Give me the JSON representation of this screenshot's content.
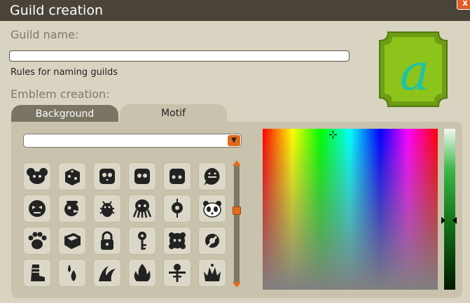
{
  "window": {
    "title": "Guild creation",
    "close_label": "x"
  },
  "form": {
    "guild_name_label": "Guild name:",
    "guild_name_value": "",
    "rules_link": "Rules for naming guilds",
    "emblem_label": "Emblem creation:"
  },
  "emblem_preview": {
    "letter": "a",
    "shield_color": "#88c21a",
    "letter_color": "#24c0a2"
  },
  "tabs": [
    {
      "label": "Background",
      "active": false
    },
    {
      "label": "Motif",
      "active": true
    }
  ],
  "motif": {
    "category_value": "",
    "icons": [
      "koala-icon",
      "dice-icon",
      "owl-face-icon",
      "cube-eyes-icon",
      "square-face-icon",
      "ghost-face-icon",
      "mask-face-icon",
      "pirate-bird-icon",
      "beetle-icon",
      "octopus-icon",
      "hanging-eye-icon",
      "panda-icon",
      "paw-icon",
      "book-icon",
      "padlock-icon",
      "key-icon",
      "flower-face-icon",
      "gear-wrench-icon",
      "boot-icon",
      "droplets-icon",
      "wave-icon",
      "flame-icon",
      "scarecrow-icon",
      "crown-icon"
    ]
  },
  "color_picker": {
    "selected_hue_position": 0.4,
    "luminance_level": 0.45,
    "selected_color": "#24c0a2"
  }
}
